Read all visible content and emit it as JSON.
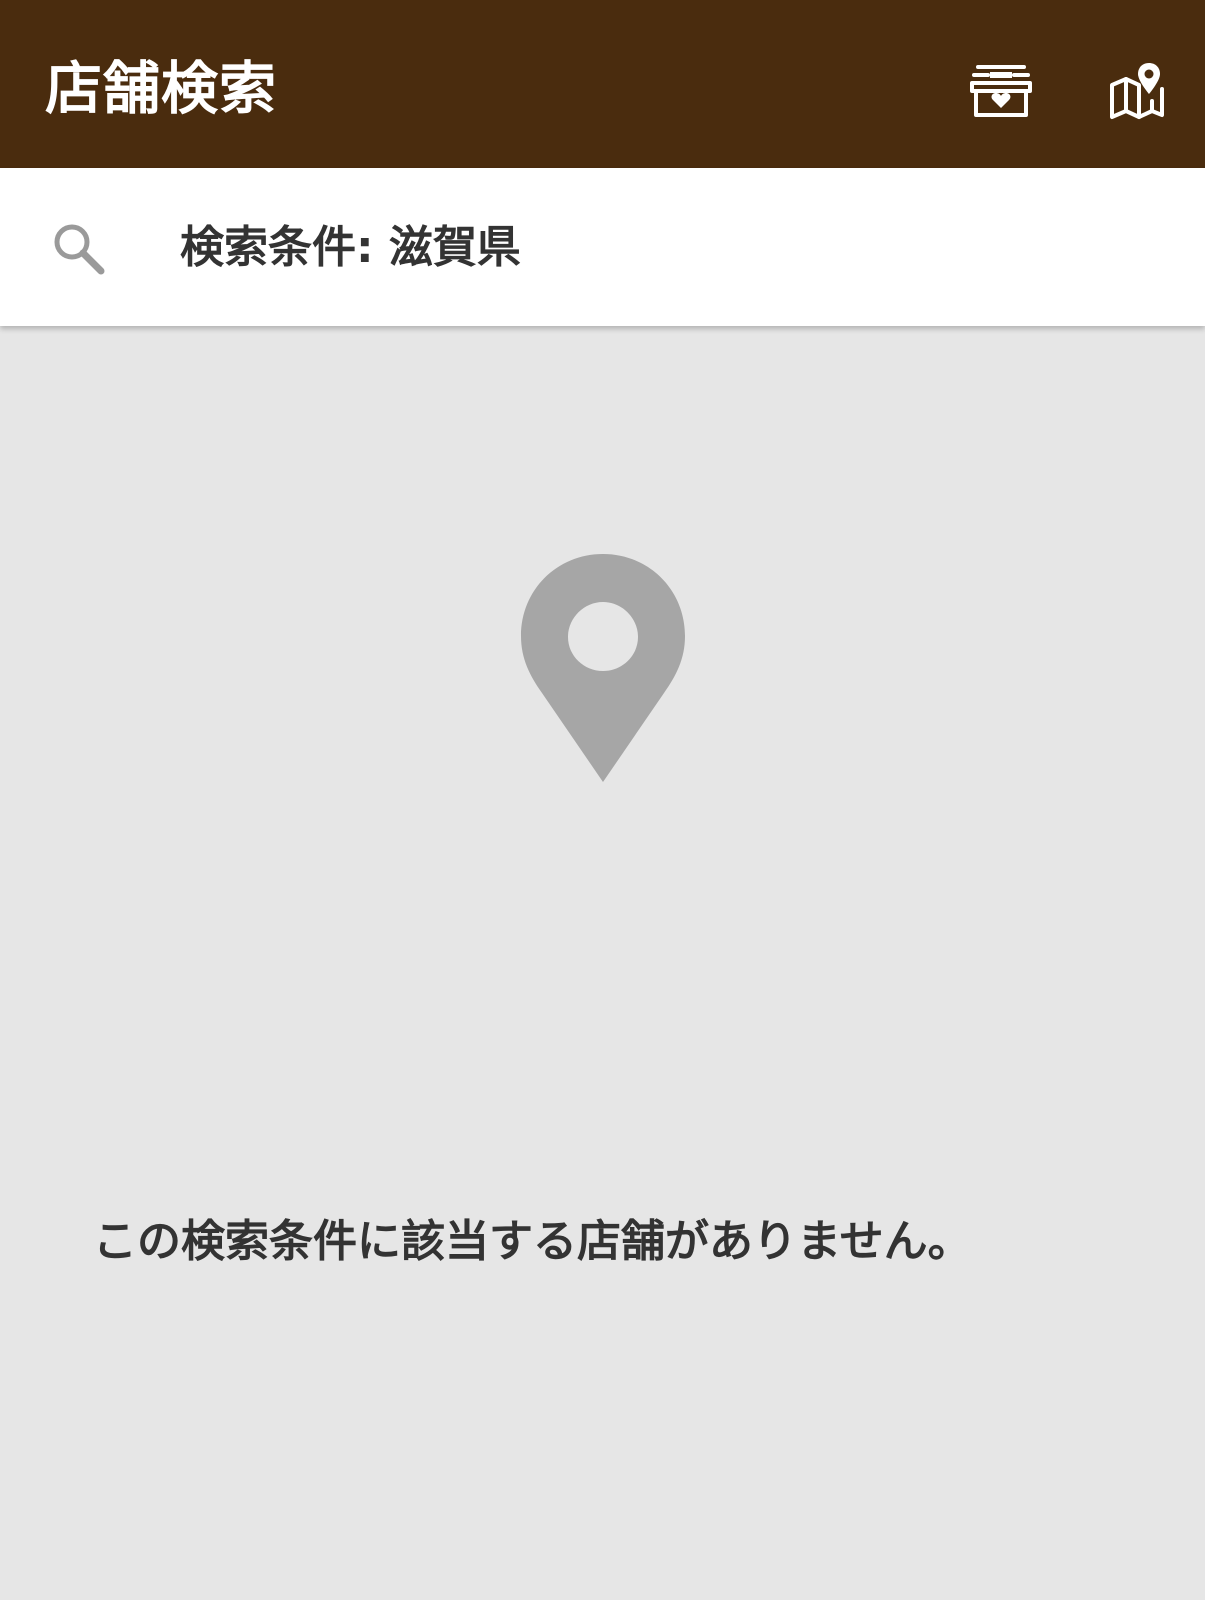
{
  "header": {
    "title": "店舗検索",
    "shop_icon": "favorite-shop-icon",
    "map_icon": "map-location-icon",
    "background_color": "#4a2c0e"
  },
  "search": {
    "icon": "search-icon",
    "condition_text": "検索条件: 滋賀県"
  },
  "empty_state": {
    "icon": "map-pin-icon",
    "message": "この検索条件に該当する店舗がありません。"
  }
}
